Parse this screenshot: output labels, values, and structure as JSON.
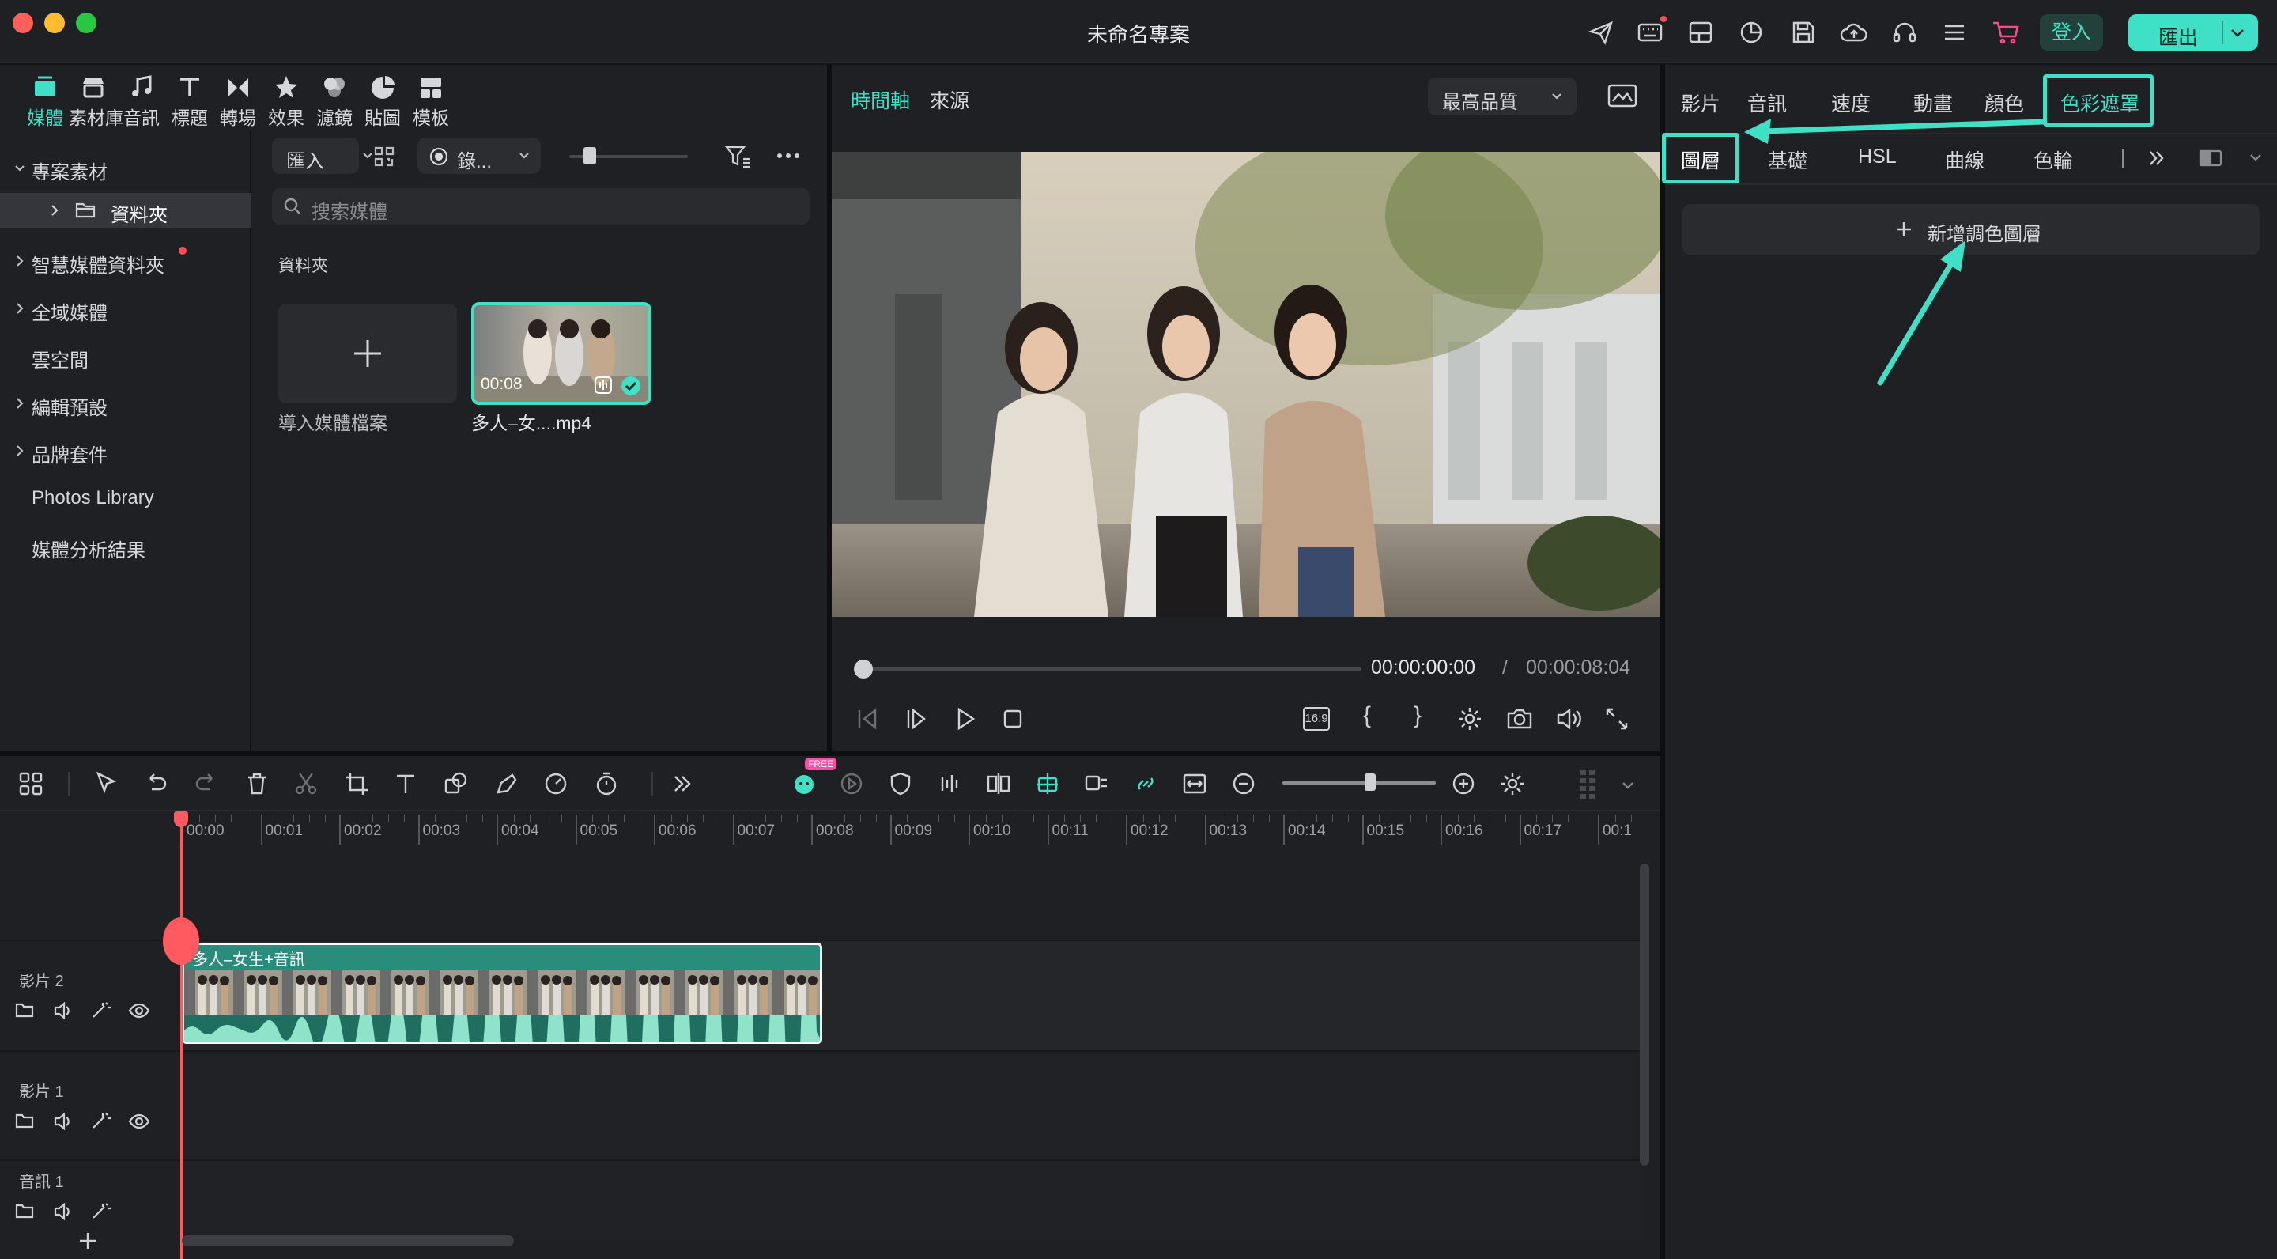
{
  "window": {
    "title": "未命名專案"
  },
  "titlebar": {
    "login_label": "登入",
    "export_label": "匯出"
  },
  "media_tabs": [
    {
      "label": "媒體",
      "icon": "media-icon",
      "active": true
    },
    {
      "label": "素材庫",
      "icon": "store-icon"
    },
    {
      "label": "音訊",
      "icon": "music-note-icon"
    },
    {
      "label": "標題",
      "icon": "title-t-icon"
    },
    {
      "label": "轉場",
      "icon": "transition-icon"
    },
    {
      "label": "效果",
      "icon": "effects-icon"
    },
    {
      "label": "濾鏡",
      "icon": "filter-icon"
    },
    {
      "label": "貼圖",
      "icon": "sticker-icon"
    },
    {
      "label": "模板",
      "icon": "template-icon"
    }
  ],
  "sidebar": {
    "project_assets": "專案素材",
    "folder": "資料夾",
    "items": [
      "智慧媒體資料夾",
      "全域媒體",
      "雲空間",
      "編輯預設",
      "品牌套件",
      "Photos Library",
      "媒體分析結果"
    ]
  },
  "media_panel": {
    "import_label": "匯入",
    "record_label": "錄...",
    "search_placeholder": "搜索媒體",
    "section_title": "資料夾",
    "import_tile_label": "導入媒體檔案",
    "clip_name": "多人–女....mp4",
    "clip_duration": "00:08"
  },
  "preview": {
    "tab_timeline": "時間軸",
    "tab_source": "來源",
    "quality": "最高品質",
    "current_time": "00:00:00:00",
    "divider": "/",
    "total_time": "00:00:08:04",
    "aspect": "16:9"
  },
  "props": {
    "tabs": [
      "影片",
      "音訊",
      "速度",
      "動畫",
      "顏色",
      "色彩遮罩"
    ],
    "active_tab": "色彩遮罩",
    "subtabs": [
      "圖層",
      "基礎",
      "HSL",
      "曲線",
      "色輪"
    ],
    "active_subtab": "圖層",
    "add_layer_label": "新增調色圖層",
    "accent": "#3fe0c5"
  },
  "timeline": {
    "ruler": [
      "00:00",
      "00:01",
      "00:02",
      "00:03",
      "00:04",
      "00:05",
      "00:06",
      "00:07",
      "00:08",
      "00:09",
      "00:10",
      "00:11",
      "00:12",
      "00:13",
      "00:14",
      "00:15",
      "00:16",
      "00:17",
      "00:1"
    ],
    "tracks": [
      {
        "label": "影片 2"
      },
      {
        "label": "影片 1"
      },
      {
        "label": "音訊 1"
      }
    ],
    "clip_label": "多人–女生+音訊",
    "free_badge": "FREE"
  }
}
